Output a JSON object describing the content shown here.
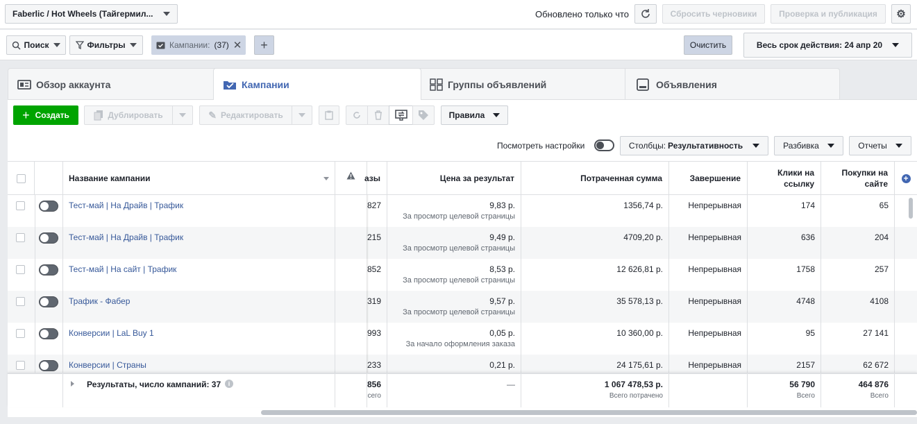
{
  "topbar": {
    "account": "Faberlic / Hot Wheels (Тайгермил...",
    "updated": "Обновлено только что",
    "discard": "Сбросить черновики",
    "publish": "Проверка и публикация"
  },
  "filterbar": {
    "search": "Поиск",
    "filters": "Фильтры",
    "chip_label": "Кампании:",
    "chip_count": "(37)",
    "clear": "Очистить",
    "date_range": "Весь срок действия: 24 апр 20"
  },
  "tabs": [
    "Обзор аккаунта",
    "Кампании",
    "Группы объявлений",
    "Объявления"
  ],
  "toolbar": {
    "create": "Создать",
    "duplicate": "Дублировать",
    "edit": "Редактировать",
    "rules": "Правила",
    "view_settings": "Посмотреть настройки",
    "columns_prefix": "Столбцы:",
    "columns_value": "Результативность",
    "breakdown": "Разбивка",
    "reports": "Отчеты"
  },
  "table": {
    "headers": {
      "name": "Название кампании",
      "results_partial": "азы",
      "cost": "Цена за результат",
      "spent": "Потраченная сумма",
      "ends": "Завершение",
      "clicks_1": "Клики на",
      "clicks_2": "ссылку",
      "purchases_1": "Покупки на",
      "purchases_2": "сайте"
    },
    "rows": [
      {
        "name": "Тест-май | На Драйв | Трафик",
        "res": "827",
        "cost": "9,83 р.",
        "cost_sub": "За просмотр целевой страницы",
        "spent": "1356,74 р.",
        "ends": "Непрерывная",
        "clicks": "174",
        "purchases": "65"
      },
      {
        "name": "Тест-май | На Драйв | Трафик",
        "res": "215",
        "cost": "9,49 р.",
        "cost_sub": "За просмотр целевой страницы",
        "spent": "4709,20 р.",
        "ends": "Непрерывная",
        "clicks": "636",
        "purchases": "204"
      },
      {
        "name": "Тест-май | На сайт | Трафик",
        "res": "852",
        "cost": "8,53 р.",
        "cost_sub": "За просмотр целевой страницы",
        "spent": "12 626,81 р.",
        "ends": "Непрерывная",
        "clicks": "1758",
        "purchases": "257"
      },
      {
        "name": "Трафик - Фабер",
        "res": "319",
        "cost": "9,57 р.",
        "cost_sub": "За просмотр целевой страницы",
        "spent": "35 578,13 р.",
        "ends": "Непрерывная",
        "clicks": "4748",
        "purchases": "4108"
      },
      {
        "name": "Конверсии | LaL Buy 1",
        "res": "993",
        "cost": "0,05 р.",
        "cost_sub": "За начало оформления заказа",
        "spent": "10 360,00 р.",
        "ends": "Непрерывная",
        "clicks": "95",
        "purchases": "27 141"
      },
      {
        "name": "Конверсии | Страны",
        "res": "233",
        "cost": "0,21 р.",
        "cost_sub": "",
        "spent": "24 175,61 р.",
        "ends": "Непрерывная",
        "clicks": "2157",
        "purchases": "62 672"
      }
    ],
    "footer": {
      "label": "Результаты, число кампаний: 37",
      "res": "856",
      "res_sub": "сего",
      "cost": "—",
      "spent": "1 067 478,53 р.",
      "spent_sub": "Всего потрачено",
      "clicks": "56 790",
      "clicks_sub": "Всего",
      "purchases": "464 876",
      "purchases_sub": "Всего"
    }
  },
  "colors": {
    "accent": "#4267b2",
    "create": "#00a400",
    "link": "#365899"
  }
}
